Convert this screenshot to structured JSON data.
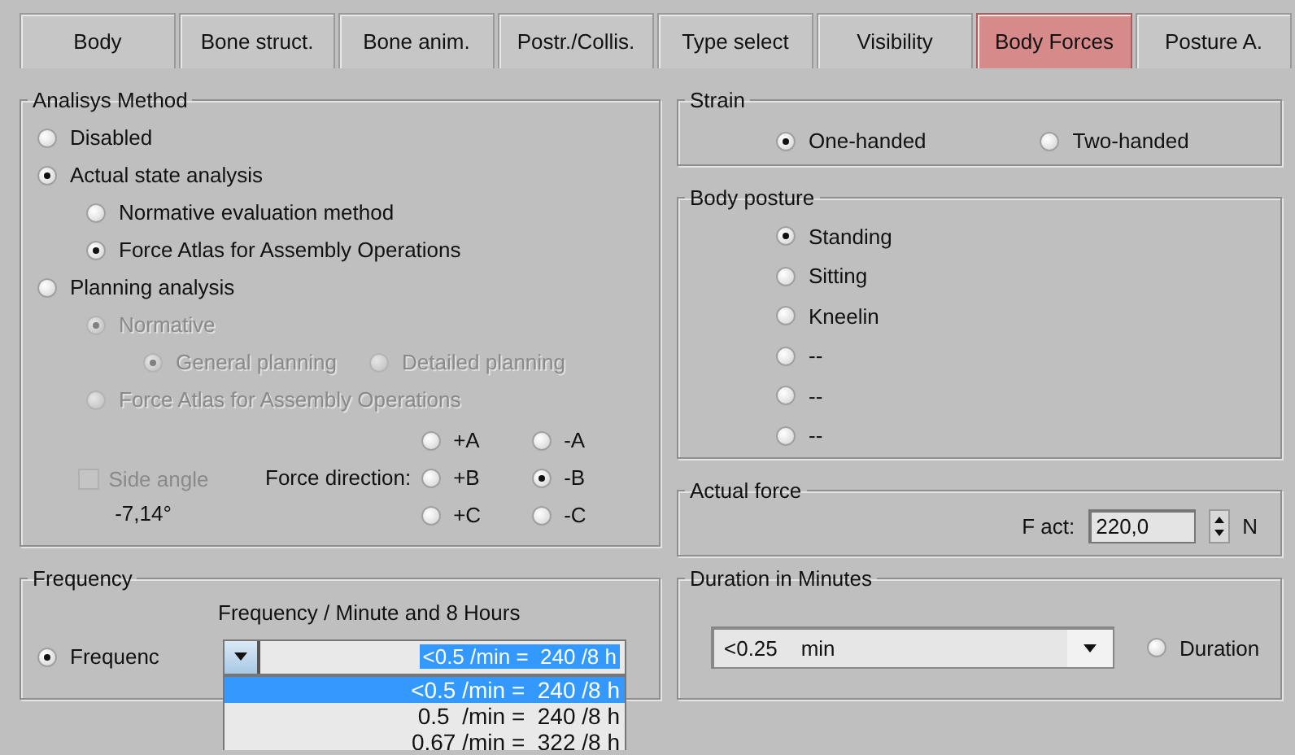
{
  "tabs": [
    {
      "label": "Body",
      "selected": false
    },
    {
      "label": "Bone struct.",
      "selected": false
    },
    {
      "label": "Bone anim.",
      "selected": false
    },
    {
      "label": "Postr./Collis.",
      "selected": false
    },
    {
      "label": "Type select",
      "selected": false
    },
    {
      "label": "Visibility",
      "selected": false
    },
    {
      "label": "Body Forces",
      "selected": true
    },
    {
      "label": "Posture A.",
      "selected": false
    }
  ],
  "analysis": {
    "title": "Analisys Method",
    "options": [
      {
        "label": "Disabled",
        "selected": false,
        "disabled": false
      },
      {
        "label": "Actual state analysis",
        "selected": true,
        "disabled": false,
        "children": [
          {
            "label": "Normative evaluation method",
            "selected": false,
            "disabled": false
          },
          {
            "label": "Force Atlas for Assembly Operations",
            "selected": true,
            "disabled": false
          }
        ]
      },
      {
        "label": "Planning analysis",
        "selected": false,
        "disabled": false,
        "children": [
          {
            "label": "Normative",
            "selected": true,
            "disabled": true,
            "children": [
              {
                "label": "General planning",
                "selected": true,
                "disabled": true
              },
              {
                "label": "Detailed planning",
                "selected": false,
                "disabled": true
              }
            ]
          },
          {
            "label": "Force Atlas for Assembly Operations",
            "selected": false,
            "disabled": true
          }
        ]
      }
    ],
    "side_angle": {
      "label": "Side angle",
      "checked": false,
      "disabled": true,
      "value": "-7,14°"
    },
    "force_direction": {
      "label": "Force direction:",
      "options": [
        {
          "label": "+A",
          "selected": false
        },
        {
          "label": "-A",
          "selected": false
        },
        {
          "label": "+B",
          "selected": false
        },
        {
          "label": "-B",
          "selected": true
        },
        {
          "label": "+C",
          "selected": false
        },
        {
          "label": "-C",
          "selected": false
        }
      ]
    }
  },
  "frequency": {
    "title": "Frequency",
    "caption": "Frequency / Minute and 8 Hours",
    "radio": {
      "label": "Frequenc",
      "selected": true
    },
    "combo": {
      "value": "<0.5 /min =  240 /8 h",
      "expanded": true,
      "items": [
        {
          "label": "<0.5 /min =  240 /8 h",
          "selected": true
        },
        {
          "label": "0.5  /min =  240 /8 h",
          "selected": false
        },
        {
          "label": "0.67 /min =  322 /8 h",
          "selected": false
        }
      ]
    }
  },
  "strain": {
    "title": "Strain",
    "options": [
      {
        "label": "One-handed",
        "selected": true
      },
      {
        "label": "Two-handed",
        "selected": false
      }
    ]
  },
  "posture": {
    "title": "Body posture",
    "options": [
      {
        "label": "Standing",
        "selected": true
      },
      {
        "label": "Sitting",
        "selected": false
      },
      {
        "label": "Kneelin",
        "selected": false
      },
      {
        "label": "--",
        "selected": false
      },
      {
        "label": "--",
        "selected": false
      },
      {
        "label": "--",
        "selected": false
      }
    ]
  },
  "actual_force": {
    "title": "Actual force",
    "label": "F act:",
    "value": "220,0",
    "unit": "N"
  },
  "duration": {
    "title": "Duration in Minutes",
    "value": "<0.25    min",
    "radio": {
      "label": "Duration",
      "selected": false
    }
  }
}
